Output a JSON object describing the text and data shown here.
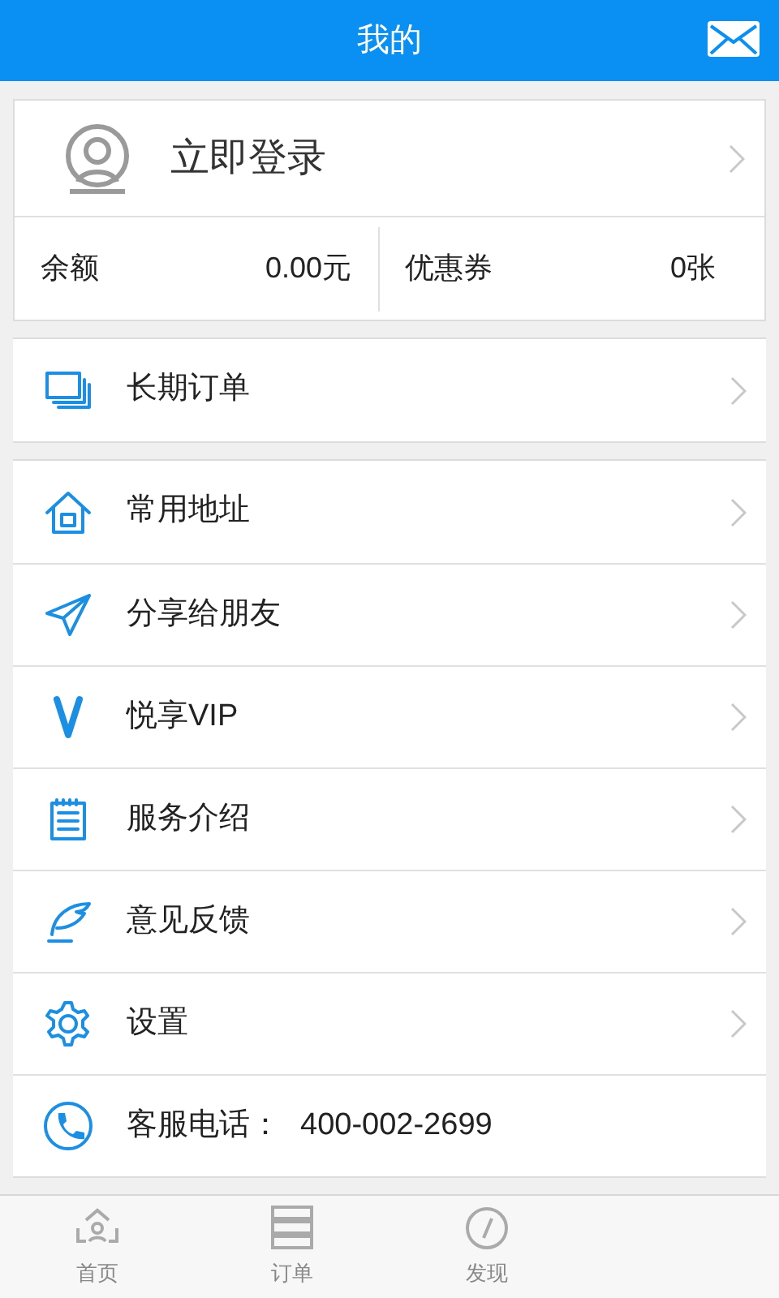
{
  "header": {
    "title": "我的"
  },
  "account": {
    "login": "立即登录",
    "balance": {
      "label": "余额",
      "value": "0.00元"
    },
    "coupons": {
      "label": "优惠券",
      "value": "0张"
    }
  },
  "groups": [
    {
      "items": [
        {
          "kind": "orders",
          "label": "长期订单"
        }
      ]
    },
    {
      "items": [
        {
          "kind": "home",
          "label": "常用地址"
        },
        {
          "kind": "send",
          "label": "分享给朋友"
        },
        {
          "kind": "vip",
          "label": "悦享VIP"
        },
        {
          "kind": "notes",
          "label": "服务介绍"
        },
        {
          "kind": "feather",
          "label": "意见反馈"
        },
        {
          "kind": "gear",
          "label": "设置"
        },
        {
          "kind": "phone",
          "label": "客服电话：",
          "value": "400-002-2699"
        }
      ]
    }
  ],
  "tabs": [
    {
      "label": "首页",
      "kind": "home",
      "selected": false
    },
    {
      "label": "订单",
      "kind": "list",
      "selected": false
    },
    {
      "label": "发现",
      "kind": "compass",
      "selected": false
    }
  ]
}
